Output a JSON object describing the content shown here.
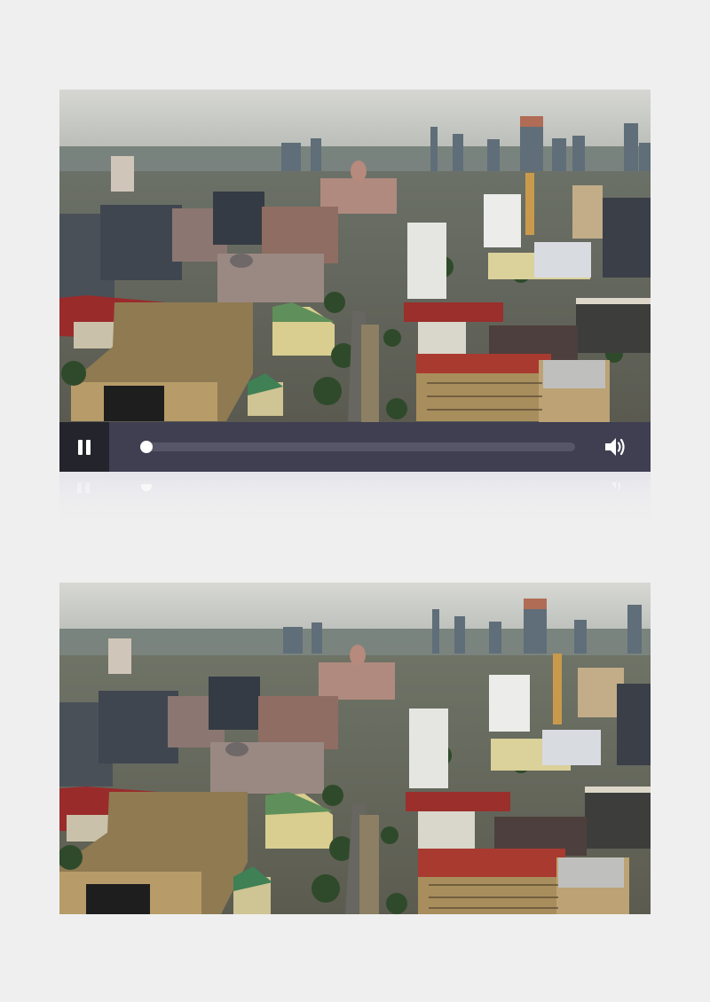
{
  "player": {
    "state": "playing",
    "pause_icon": "pause-icon",
    "volume_icon": "volume-icon",
    "progress_fraction": 0.0
  },
  "video": {
    "scene": "aerial-city-skyline"
  },
  "colors": {
    "controls_bg": "#3f3f51",
    "play_box_bg": "#24242c",
    "track": "#565668",
    "page_bg": "#efefef"
  }
}
